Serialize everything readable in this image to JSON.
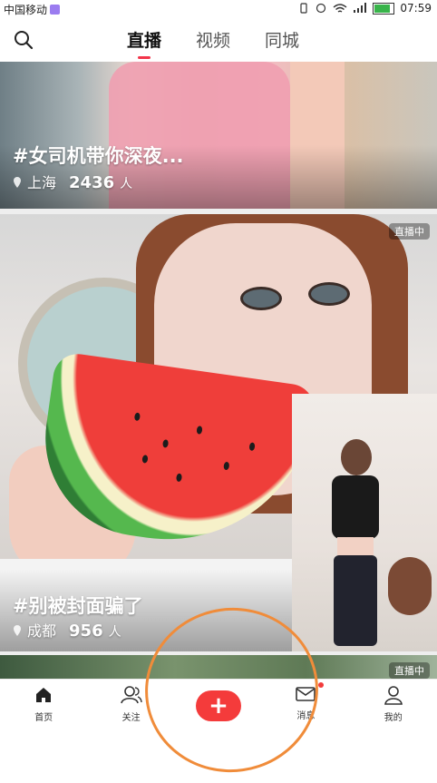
{
  "status_bar": {
    "carrier": "中国移动",
    "time": "07:59"
  },
  "top_nav": {
    "tabs": [
      "直播",
      "视频",
      "同城"
    ],
    "active_tab": 0
  },
  "feed": [
    {
      "title": "#女司机带你深夜...",
      "location": "上海",
      "count": "2436",
      "unit": "人"
    },
    {
      "title": "#别被封面骗了",
      "location": "成都",
      "count": "956",
      "unit": "人",
      "badge": "直播中"
    },
    {
      "badge": "直播中"
    }
  ],
  "bottom_tabs": [
    {
      "label": "首页",
      "icon": "home-icon"
    },
    {
      "label": "关注",
      "icon": "users-icon"
    },
    {
      "label": "",
      "icon": "plus-icon"
    },
    {
      "label": "消息",
      "icon": "mail-icon"
    },
    {
      "label": "我的",
      "icon": "person-icon"
    }
  ],
  "colors": {
    "accent": "#f2354a",
    "plus_button": "#f43b3b",
    "annotation": "#f08c3a"
  }
}
